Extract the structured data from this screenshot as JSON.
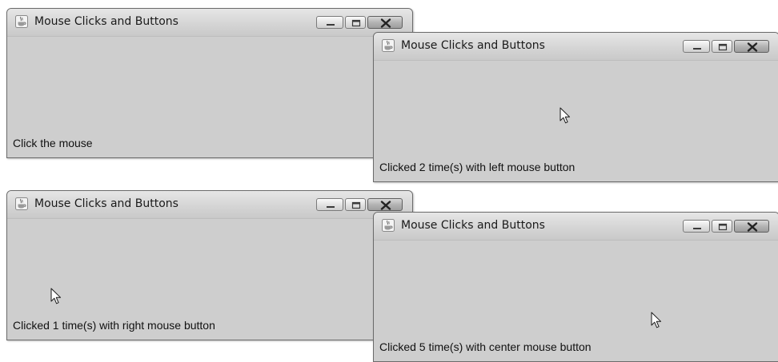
{
  "windows": [
    {
      "title": "Mouse Clicks and Buttons",
      "status": "Click the mouse",
      "show_cursor": false
    },
    {
      "title": "Mouse Clicks and Buttons",
      "status": "Clicked 2 time(s) with left mouse button",
      "show_cursor": true
    },
    {
      "title": "Mouse Clicks and Buttons",
      "status": "Clicked 1 time(s) with right mouse button",
      "show_cursor": true
    },
    {
      "title": "Mouse Clicks and Buttons",
      "status": "Clicked 5 time(s) with center mouse button",
      "show_cursor": true
    }
  ],
  "icons": {
    "app": "java-cup-icon",
    "minimize": "minimize-icon",
    "maximize": "maximize-icon",
    "close": "close-icon",
    "cursor": "mouse-pointer-icon"
  },
  "colors": {
    "content_bg": "#cecece",
    "titlebar_top": "#e6e6e6",
    "titlebar_bottom": "#c9c9c9",
    "text": "#111111"
  }
}
